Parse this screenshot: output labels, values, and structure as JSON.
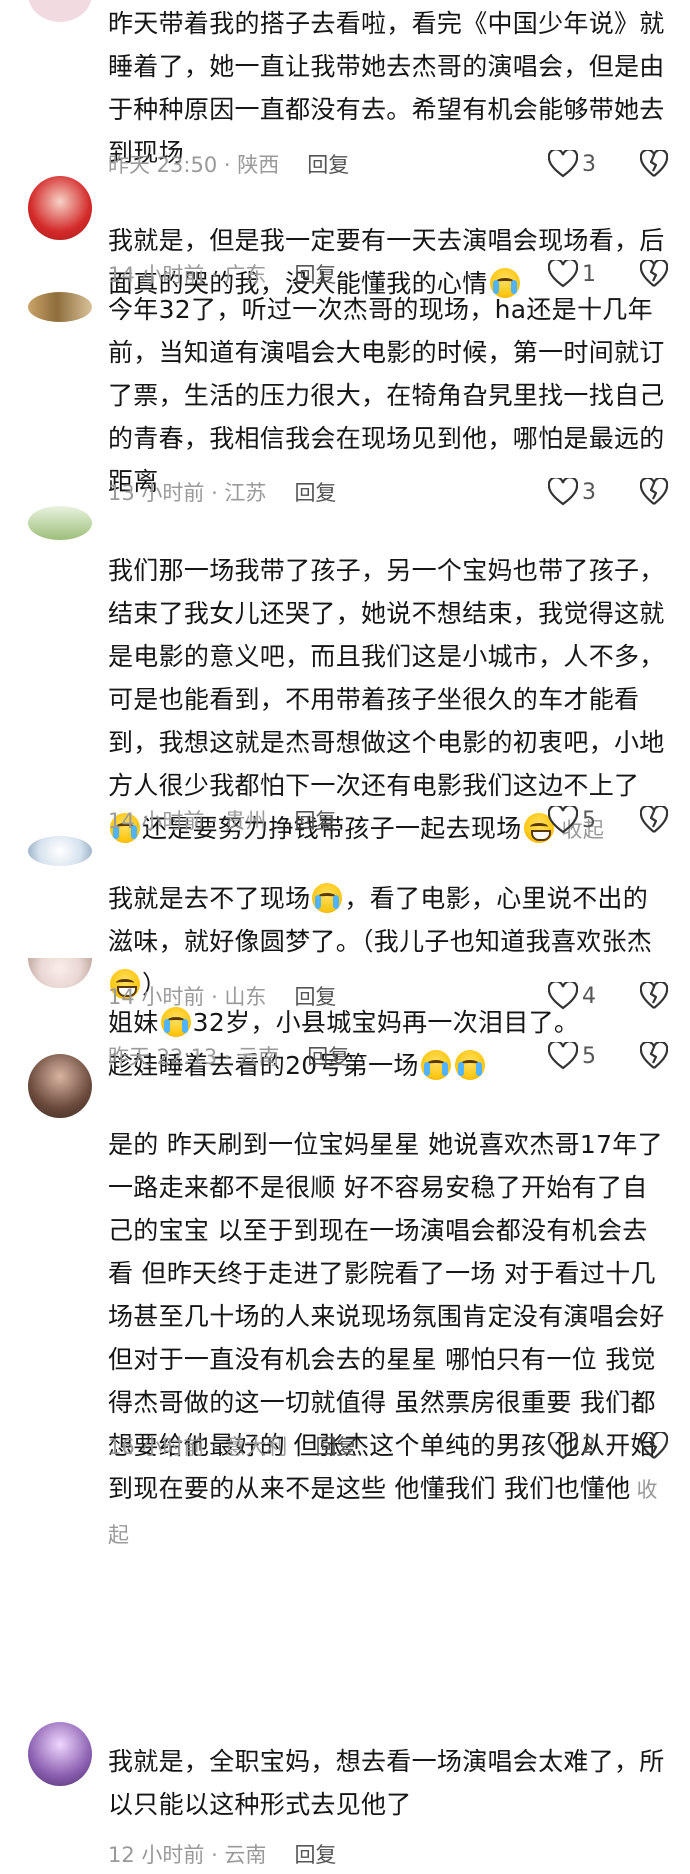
{
  "comments": [
    {
      "text": "昨天带着我的搭子去看啦，看完《中国少年说》就睡着了，她一直让我带她去杰哥的演唱会，但是由于种种原因一直都没有去。希望有机会能够带她去到现场",
      "time_location": "昨天 23:50 · 陕西",
      "reply_label": "回复",
      "likes": "3",
      "avatar_color": "#f2dbe0"
    },
    {
      "text_parts": [
        "我就是，但是我一定要有一天去演唱会现场看，后面真的哭的我，没人能懂我的心情"
      ],
      "time_location": "14 小时前 · 广东",
      "reply_label": "回复",
      "likes": "1",
      "avatar_color": "#d42a2a"
    },
    {
      "text": "今年32了，听过一次杰哥的现场，ha还是十几年前，当知道有演唱会大电影的时候，第一时间就订了票，生活的压力很大，在犄角旮旯里找一找自己的青春，我相信我会在现场见到他，哪怕是最远的距离",
      "time_location": "13 小时前 · 江苏",
      "reply_label": "回复",
      "likes": "3",
      "avatar_color": "#c9a15a"
    },
    {
      "text_a": "我们那一场我带了孩子，另一个宝妈也带了孩子，结束了我女儿还哭了，她说不想结束，我觉得这就是电影的意义吧，而且我们这是小城市，人不多，可是也能看到，不用带着孩子坐很久的车才能看到，我想这就是杰哥想做这个电影的初衷吧，小地方人很少我都怕下一次还有电影我们这边不上了",
      "text_b": "还是要努力挣钱带孩子一起去现场",
      "collapse_label": "收起",
      "time_location": "14 小时前 · 贵州",
      "reply_label": "回复",
      "likes": "5",
      "avatar_color": "#9dbf7a"
    },
    {
      "text_a": "我就是去不了现场",
      "text_b": "，看了电影，心里说不出的滋味，就好像圆梦了。（我儿子也知道我喜欢张杰",
      "text_c": "）",
      "time_location": "14 小时前 · 山东",
      "reply_label": "回复",
      "likes": "4",
      "avatar_color": "#b8c8d8"
    },
    {
      "text_a": "姐妹",
      "text_b": "32岁，小县城宝妈再一次泪目了。\n趁娃睡着去看的20号第一场",
      "time_location": "昨天 22:13 · 云南",
      "reply_label": "回复",
      "likes": "5",
      "avatar_color": "#e8d6d2"
    },
    {
      "text": "是的 昨天刷到一位宝妈星星 她说喜欢杰哥17年了 一路走来都不是很顺 好不容易安稳了开始有了自己的宝宝 以至于到现在一场演唱会都没有机会去看 但昨天终于走进了影院看了一场 对于看过十几场甚至几十场的人来说现场氛围肯定没有演唱会好 但对于一直没有机会去的星星 哪怕只有一位 我觉得杰哥做的这一切就值得 虽然票房很重要 我们都想要给他最好的 但张杰这个单纯的男孩 他从开始到现在要的从来不是这些 他懂我们 我们也懂他",
      "collapse_label": "收起",
      "time_location": "16 小时前 · 意大利",
      "reply_label": "回复",
      "likes": "2",
      "avatar_color": "#6b4a3c"
    },
    {
      "text": "我就是，全职宝妈，想去看一场演唱会太难了，所以只能以这种形式去见他了",
      "time_location": "12 小时前 · 云南",
      "reply_label": "回复",
      "avatar_color": "#8a5fb0"
    }
  ],
  "colors": {
    "text": "#161616",
    "meta": "#9a9a9a",
    "reply": "#555555",
    "icon": "#333333"
  }
}
